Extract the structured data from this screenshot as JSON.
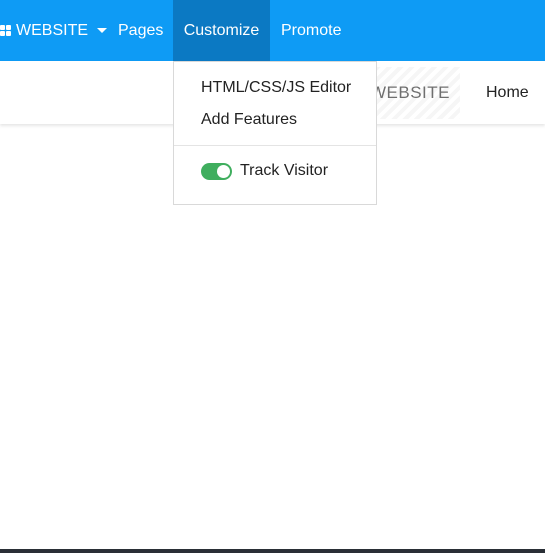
{
  "topbar": {
    "website_label": "WEBSITE",
    "pages_label": "Pages",
    "customize_label": "Customize",
    "promote_label": "Promote",
    "bg_color": "#0e9bf5",
    "active_color": "#0b79c3"
  },
  "site_header": {
    "brand": "WEBSITE",
    "home_label": "Home"
  },
  "customize_menu": {
    "items": [
      {
        "label": "HTML/CSS/JS Editor"
      },
      {
        "label": "Add Features"
      }
    ],
    "toggle": {
      "label": "Track Visitor",
      "on": true,
      "color": "#3fae5e"
    }
  },
  "icons": {
    "website": "apps-grid-icon",
    "dropdown": "caret-down-icon"
  }
}
